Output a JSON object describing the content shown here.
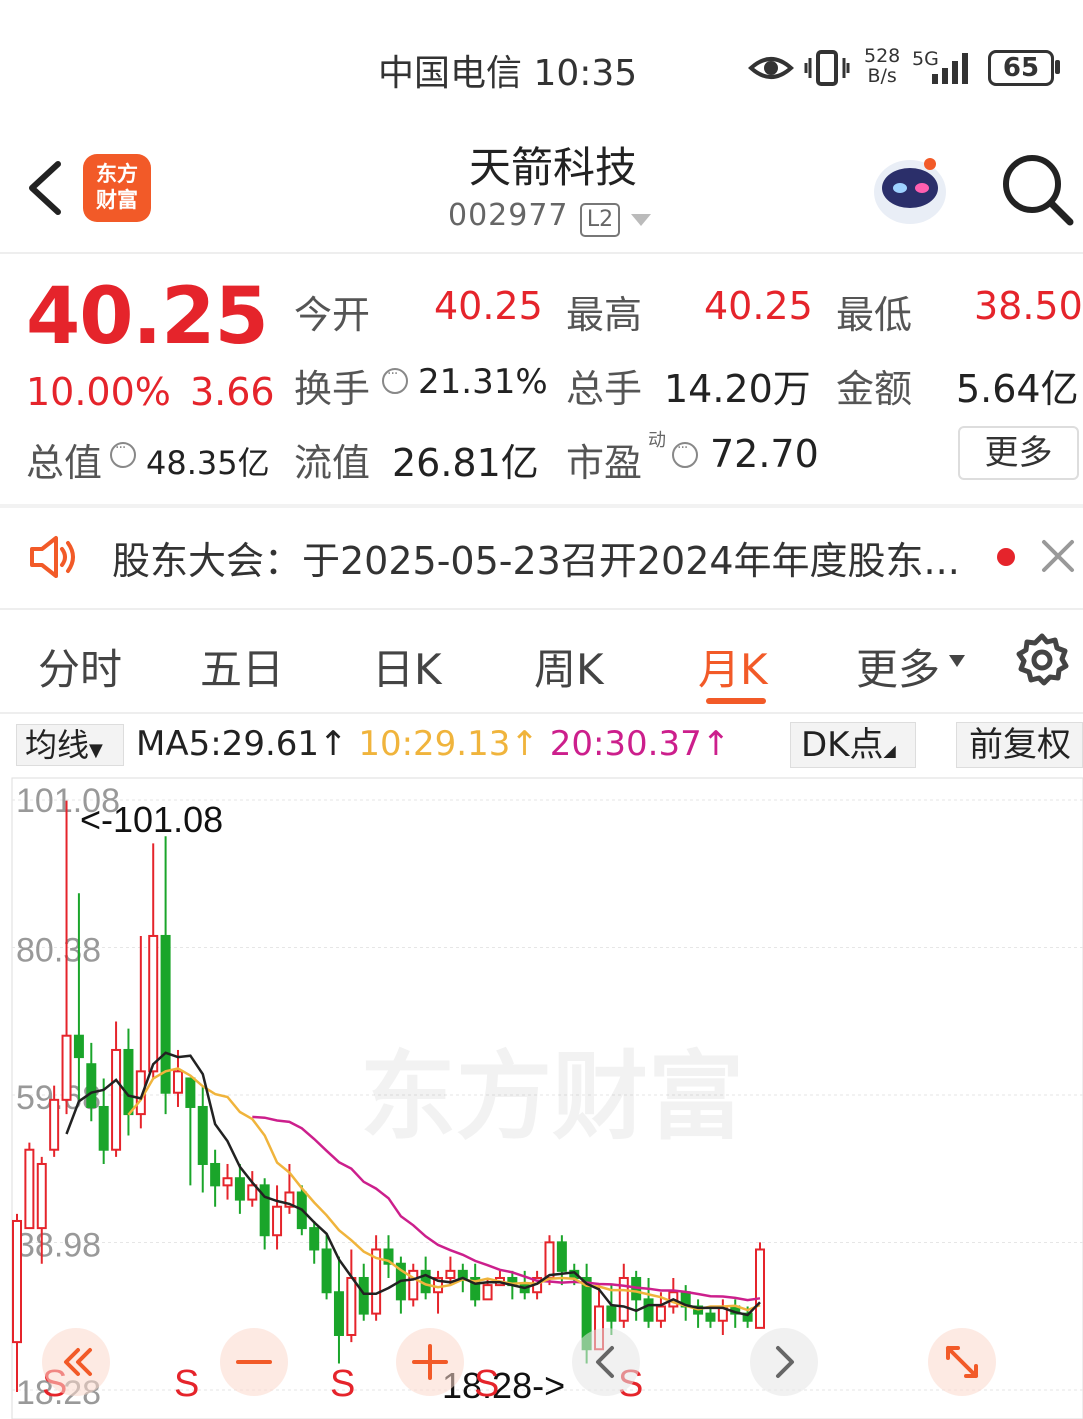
{
  "status_bar": {
    "carrier_time": "中国电信 10:35",
    "net_speed_value": "528",
    "net_speed_unit": "B/s",
    "network": "5G",
    "battery": "65"
  },
  "header": {
    "logo_text_1": "东方",
    "logo_text_2": "财富",
    "stock_name": "天箭科技",
    "stock_code": "002977",
    "level": "L2"
  },
  "quote": {
    "price": "40.25",
    "change_pct": "10.00%",
    "change_abs": "3.66",
    "open_label": "今开",
    "open_value": "40.25",
    "high_label": "最高",
    "high_value": "40.25",
    "low_label": "最低",
    "low_value": "38.50",
    "turnover_label": "换手",
    "turnover_value": "21.31%",
    "volume_label": "总手",
    "volume_value": "14.20万",
    "amount_label": "金额",
    "amount_value": "5.64亿",
    "mktcap_label": "总值",
    "mktcap_value": "48.35亿",
    "float_label": "流值",
    "float_value": "26.81亿",
    "pe_label": "市盈",
    "pe_sup": "动",
    "pe_value": "72.70",
    "more_label": "更多"
  },
  "notice": {
    "text": "股东大会：于2025-05-23召开2024年年度股东..."
  },
  "tabs": {
    "items": [
      "分时",
      "五日",
      "日K",
      "周K",
      "月K",
      "更多"
    ],
    "active": "月K"
  },
  "ma_bar": {
    "type_label": "均线",
    "ma5": "MA5:29.61",
    "ma10": "10:29.13",
    "ma20": "20:30.37",
    "arrow": "↑",
    "dk_label": "DK点",
    "adjust_label": "前复权"
  },
  "colors": {
    "up": "#e5242b",
    "down": "#1aa52a",
    "accent": "#f25a28",
    "ma5": "#222222",
    "ma10": "#f0b43c",
    "ma20": "#cc1f8c"
  },
  "chart_data": {
    "type": "candlestick",
    "y_ticks": [
      "101.08",
      "80.38",
      "59.68",
      "38.98",
      "18.28"
    ],
    "ylim": [
      18.28,
      101.08
    ],
    "max_label": "<-101.08",
    "min_label": "18.28->",
    "watermark": "东方财富",
    "signal_labels": [
      "S",
      "S",
      "S",
      "S",
      "S"
    ],
    "candles": [
      [
        25,
        42,
        43,
        18
      ],
      [
        41,
        52,
        53,
        41
      ],
      [
        41,
        50,
        51,
        36
      ],
      [
        52,
        59,
        61,
        51
      ],
      [
        59,
        68,
        101,
        57
      ],
      [
        68,
        65,
        88,
        59
      ],
      [
        64,
        58,
        67,
        56
      ],
      [
        58,
        52,
        62,
        50
      ],
      [
        52,
        66,
        70,
        51
      ],
      [
        66,
        57,
        69,
        54
      ],
      [
        57,
        63,
        82,
        55
      ],
      [
        63,
        82,
        95,
        62
      ],
      [
        82,
        60,
        96,
        57
      ],
      [
        60,
        63,
        66,
        58
      ],
      [
        62,
        58,
        62,
        47
      ],
      [
        58,
        50,
        61,
        46
      ],
      [
        50,
        47,
        52,
        44
      ],
      [
        47,
        48,
        50,
        45
      ],
      [
        48,
        45,
        50,
        43
      ],
      [
        45,
        47,
        49,
        44
      ],
      [
        47,
        40,
        48,
        38
      ],
      [
        40,
        44,
        47,
        38
      ],
      [
        44,
        46,
        50,
        43
      ],
      [
        46,
        41,
        47,
        40
      ],
      [
        41,
        38,
        42,
        36
      ],
      [
        38,
        32,
        40,
        31
      ],
      [
        32,
        26,
        37,
        22
      ],
      [
        26,
        34,
        38,
        25
      ],
      [
        34,
        29,
        36,
        28
      ],
      [
        29,
        38,
        40,
        28
      ],
      [
        38,
        36,
        40,
        34
      ],
      [
        36,
        31,
        37,
        29
      ],
      [
        31,
        35,
        36,
        30
      ],
      [
        35,
        32,
        37,
        31
      ],
      [
        32,
        34,
        35,
        29
      ],
      [
        34,
        35,
        37,
        33
      ],
      [
        35,
        34,
        36,
        32
      ],
      [
        34,
        31,
        36,
        30
      ],
      [
        31,
        33,
        34,
        31
      ],
      [
        33,
        34,
        35,
        33
      ],
      [
        34,
        33,
        35,
        31
      ],
      [
        33,
        32,
        35,
        31
      ],
      [
        32,
        34,
        35,
        31
      ],
      [
        34,
        39,
        40,
        33
      ],
      [
        39,
        35,
        40,
        33
      ],
      [
        35,
        34,
        36,
        33
      ],
      [
        34,
        24,
        36,
        22
      ],
      [
        24,
        30,
        33,
        24
      ],
      [
        30,
        28,
        33,
        26
      ],
      [
        28,
        34,
        36,
        27
      ],
      [
        34,
        31,
        35,
        28
      ],
      [
        31,
        28,
        34,
        27
      ],
      [
        28,
        30,
        32,
        27
      ],
      [
        30,
        32,
        34,
        29
      ],
      [
        32,
        30,
        33,
        28
      ],
      [
        30,
        29,
        31,
        27
      ],
      [
        29,
        28,
        30,
        27
      ],
      [
        28,
        30,
        31,
        26
      ],
      [
        30,
        29,
        31,
        27
      ],
      [
        29,
        28,
        30,
        27
      ],
      [
        27,
        38,
        39,
        27
      ]
    ]
  }
}
